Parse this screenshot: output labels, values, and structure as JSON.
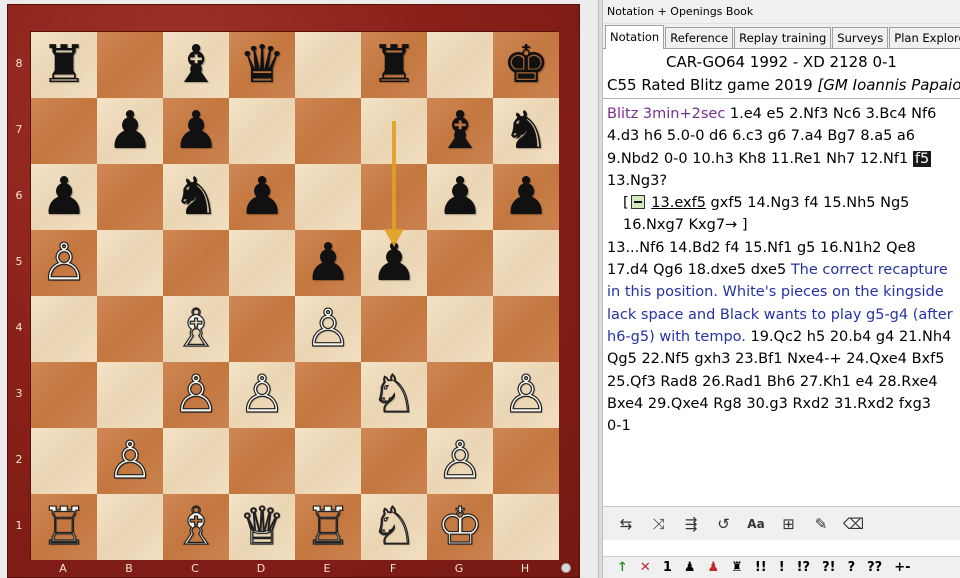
{
  "board": {
    "files": [
      "A",
      "B",
      "C",
      "D",
      "E",
      "F",
      "G",
      "H"
    ],
    "ranks": [
      "8",
      "7",
      "6",
      "5",
      "4",
      "3",
      "2",
      "1"
    ],
    "pieces": [
      {
        "square": "a8",
        "color": "black",
        "type": "rook",
        "glyph": "♜"
      },
      {
        "square": "c8",
        "color": "black",
        "type": "bishop",
        "glyph": "♝"
      },
      {
        "square": "d8",
        "color": "black",
        "type": "queen",
        "glyph": "♛"
      },
      {
        "square": "f8",
        "color": "black",
        "type": "rook",
        "glyph": "♜"
      },
      {
        "square": "h8",
        "color": "black",
        "type": "king",
        "glyph": "♚"
      },
      {
        "square": "b7",
        "color": "black",
        "type": "pawn",
        "glyph": "♟"
      },
      {
        "square": "c7",
        "color": "black",
        "type": "pawn",
        "glyph": "♟"
      },
      {
        "square": "g7",
        "color": "black",
        "type": "bishop",
        "glyph": "♝"
      },
      {
        "square": "h7",
        "color": "black",
        "type": "knight",
        "glyph": "♞"
      },
      {
        "square": "a6",
        "color": "black",
        "type": "pawn",
        "glyph": "♟"
      },
      {
        "square": "c6",
        "color": "black",
        "type": "knight",
        "glyph": "♞"
      },
      {
        "square": "d6",
        "color": "black",
        "type": "pawn",
        "glyph": "♟"
      },
      {
        "square": "g6",
        "color": "black",
        "type": "pawn",
        "glyph": "♟"
      },
      {
        "square": "h6",
        "color": "black",
        "type": "pawn",
        "glyph": "♟"
      },
      {
        "square": "e5",
        "color": "black",
        "type": "pawn",
        "glyph": "♟"
      },
      {
        "square": "f5",
        "color": "black",
        "type": "pawn",
        "glyph": "♟"
      },
      {
        "square": "a5",
        "color": "white",
        "type": "pawn",
        "glyph": "♙"
      },
      {
        "square": "c4",
        "color": "white",
        "type": "bishop",
        "glyph": "♗"
      },
      {
        "square": "e4",
        "color": "white",
        "type": "pawn",
        "glyph": "♙"
      },
      {
        "square": "c3",
        "color": "white",
        "type": "pawn",
        "glyph": "♙"
      },
      {
        "square": "d3",
        "color": "white",
        "type": "pawn",
        "glyph": "♙"
      },
      {
        "square": "f3",
        "color": "white",
        "type": "knight",
        "glyph": "♘"
      },
      {
        "square": "h3",
        "color": "white",
        "type": "pawn",
        "glyph": "♙"
      },
      {
        "square": "b2",
        "color": "white",
        "type": "pawn",
        "glyph": "♙"
      },
      {
        "square": "g2",
        "color": "white",
        "type": "pawn",
        "glyph": "♙"
      },
      {
        "square": "a1",
        "color": "white",
        "type": "rook",
        "glyph": "♖"
      },
      {
        "square": "c1",
        "color": "white",
        "type": "bishop",
        "glyph": "♗"
      },
      {
        "square": "d1",
        "color": "white",
        "type": "queen",
        "glyph": "♕"
      },
      {
        "square": "e1",
        "color": "white",
        "type": "rook",
        "glyph": "♖"
      },
      {
        "square": "f1",
        "color": "white",
        "type": "knight",
        "glyph": "♘"
      },
      {
        "square": "g1",
        "color": "white",
        "type": "king",
        "glyph": "♔"
      }
    ],
    "last_move_arrow": {
      "from": "f7",
      "to": "f5",
      "color": "#e0a020"
    },
    "colors": {
      "light": "#efdcbc",
      "dark": "#c97f49",
      "frame": "#8a2119"
    }
  },
  "panel": {
    "title": "Notation + Openings Book",
    "tabs": [
      {
        "label": "Notation",
        "active": true
      },
      {
        "label": "Reference",
        "active": false
      },
      {
        "label": "Replay training",
        "active": false
      },
      {
        "label": "Surveys",
        "active": false
      },
      {
        "label": "Plan Explorer",
        "active": false
      }
    ],
    "game_title": "CAR-GO64 1992 - XD 2128  0-1",
    "game_event": "C55 Rated Blitz game 2019",
    "game_annotator": "[GM Ioannis Papaioannou]",
    "time_control": "Blitz 3min+2sec",
    "mainline_1": [
      "1.e4",
      "e5",
      "2.Nf3",
      "Nc6",
      "3.Bc4",
      "Nf6",
      "4.d3",
      "h6",
      "5.0-0",
      "d6",
      "6.c3",
      "g6",
      "7.a4",
      "Bg7",
      "8.a5",
      "a6",
      "9.Nbd2",
      "0-0",
      "10.h3",
      "Kh8",
      "11.Re1",
      "Nh7",
      "12.Nf1"
    ],
    "current_move": "f5",
    "mainline_2": [
      "13.Ng3?"
    ],
    "variation": {
      "open": "[",
      "first": "13.exf5",
      "moves": [
        "gxf5",
        "14.Ng3",
        "f4",
        "15.Nh5",
        "Ng5",
        "16.Nxg7",
        "Kxg7→"
      ],
      "close": "]"
    },
    "mainline_3": [
      "13...Nf6",
      "14.Bd2",
      "f4",
      "15.Nf1",
      "g5",
      "16.N1h2",
      "Qe8",
      "17.d4",
      "Qg6",
      "18.dxe5",
      "dxe5"
    ],
    "comment": "The correct recapture in this position. White's pieces on the kingside lack space and Black wants to play g5-g4 (after h6-g5) with tempo.",
    "mainline_4": [
      "19.Qc2",
      "h5",
      "20.b4",
      "g4",
      "21.Nh4",
      "Qg5",
      "22.Nf5",
      "gxh3",
      "23.Bf1",
      "Nxe4-+",
      "24.Qxe4",
      "Bxf5",
      "25.Qf3",
      "Rad8",
      "26.Rad1",
      "Bh6",
      "27.Kh1",
      "e4",
      "28.Rxe4",
      "Bxe4",
      "29.Qxe4",
      "Rg8",
      "30.g3",
      "Rxd2",
      "31.Rxd2",
      "fxg3"
    ],
    "result": "0-1",
    "toolbar": [
      {
        "name": "insert-move-icon",
        "glyph": "⇆"
      },
      {
        "name": "variation-icon",
        "glyph": "⤨"
      },
      {
        "name": "promote-variation-icon",
        "glyph": "⇶"
      },
      {
        "name": "undo-icon",
        "glyph": "↺"
      },
      {
        "name": "text-annotation-icon",
        "glyph": "Aa",
        "text": true
      },
      {
        "name": "tree-icon",
        "glyph": "⊞"
      },
      {
        "name": "pen-icon",
        "glyph": "✎"
      },
      {
        "name": "eraser-icon",
        "glyph": "⌫"
      }
    ],
    "symbols": [
      {
        "label": "↑",
        "cls": "green"
      },
      {
        "label": "✕",
        "cls": "red"
      },
      {
        "label": "1",
        "cls": ""
      },
      {
        "label": "♟",
        "cls": ""
      },
      {
        "label": "♟",
        "cls": "red"
      },
      {
        "label": "♜",
        "cls": ""
      },
      {
        "label": "!!",
        "cls": ""
      },
      {
        "label": "!",
        "cls": ""
      },
      {
        "label": "!?",
        "cls": ""
      },
      {
        "label": "?!",
        "cls": ""
      },
      {
        "label": "?",
        "cls": ""
      },
      {
        "label": "??",
        "cls": ""
      },
      {
        "label": "+-",
        "cls": ""
      }
    ]
  }
}
